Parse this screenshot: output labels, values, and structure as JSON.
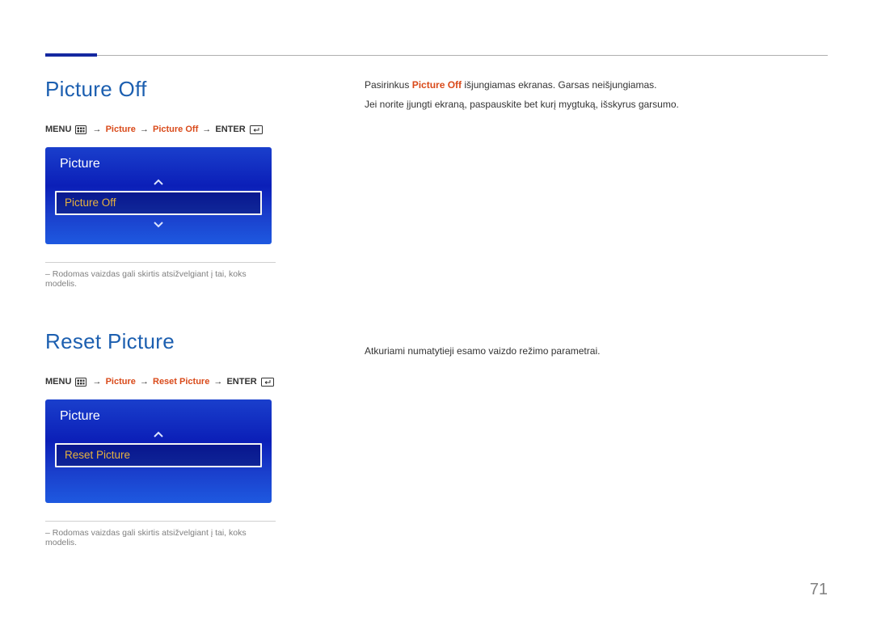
{
  "page_number": "71",
  "section1": {
    "title": "Picture Off",
    "nav": {
      "menu": "MENU",
      "p1": "Picture",
      "p2": "Picture Off",
      "enter": "ENTER"
    },
    "ui": {
      "header": "Picture",
      "highlight": "Picture Off"
    },
    "footnote": "–   Rodomas vaizdas gali skirtis atsižvelgiant į tai, koks modelis.",
    "desc": {
      "line1_pre": "Pasirinkus ",
      "line1_hl": "Picture Off",
      "line1_post": " išjungiamas ekranas. Garsas neišjungiamas.",
      "line2": "Jei norite įjungti ekraną, paspauskite bet kurį mygtuką, išskyrus garsumo."
    }
  },
  "section2": {
    "title": "Reset Picture",
    "nav": {
      "menu": "MENU",
      "p1": "Picture",
      "p2": "Reset Picture",
      "enter": "ENTER"
    },
    "ui": {
      "header": "Picture",
      "highlight": "Reset Picture"
    },
    "footnote": "–   Rodomas vaizdas gali skirtis atsižvelgiant į tai, koks modelis.",
    "desc": {
      "line1": "Atkuriami numatytieji esamo vaizdo režimo parametrai."
    }
  }
}
